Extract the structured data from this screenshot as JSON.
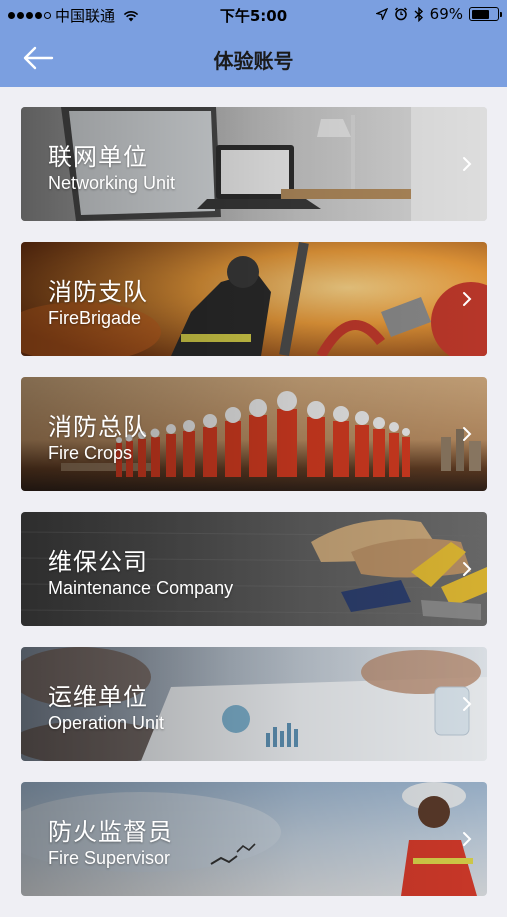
{
  "status_bar": {
    "carrier": "中国联通",
    "time": "下午5:00",
    "battery_percent": "69%",
    "battery_level": 0.69,
    "signal_bars_filled": 4,
    "signal_bars_total": 5,
    "icons": [
      "wifi-icon",
      "location-arrow-icon",
      "alarm-icon",
      "bluetooth-icon",
      "battery-icon"
    ]
  },
  "nav": {
    "title": "体验账号",
    "back_icon": "arrow-left-icon",
    "bar_color": "#7b9fe0"
  },
  "cards": [
    {
      "key": "networking-unit",
      "title_cn": "联网单位",
      "title_en": "Networking Unit"
    },
    {
      "key": "fire-brigade",
      "title_cn": "消防支队",
      "title_en": "FireBrigade"
    },
    {
      "key": "fire-crops",
      "title_cn": "消防总队",
      "title_en": "Fire Crops"
    },
    {
      "key": "maintenance-company",
      "title_cn": "维保公司",
      "title_en": "Maintenance Company"
    },
    {
      "key": "operation-unit",
      "title_cn": "运维单位",
      "title_en": "Operation Unit"
    },
    {
      "key": "fire-supervisor",
      "title_cn": "防火监督员",
      "title_en": "Fire Supervisor"
    }
  ]
}
